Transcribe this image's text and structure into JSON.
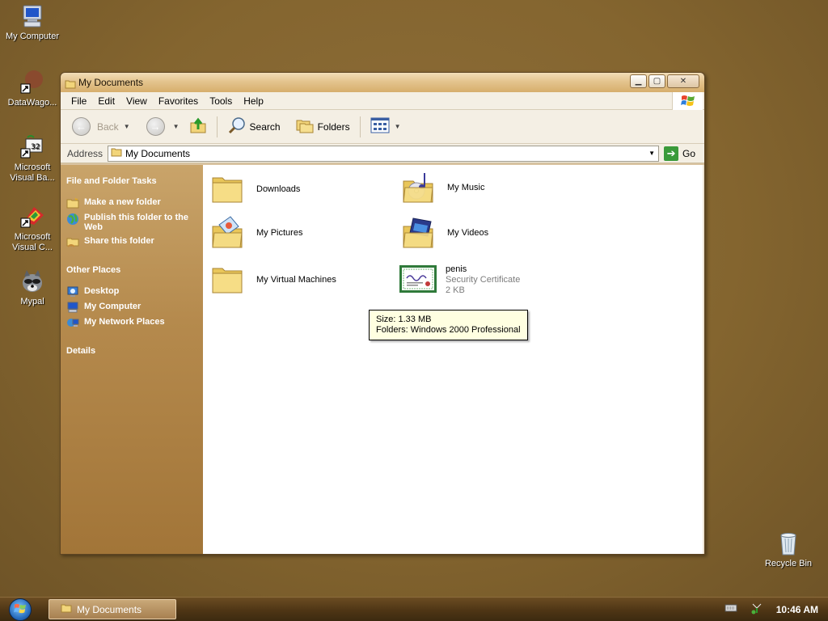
{
  "desktop": {
    "icons": [
      {
        "label": "My Computer"
      },
      {
        "label": "DataWago..."
      },
      {
        "label": "Microsoft Visual Ba..."
      },
      {
        "label": "Microsoft Visual C..."
      },
      {
        "label": "Mypal"
      },
      {
        "label": "Recycle Bin"
      }
    ]
  },
  "window": {
    "title": "My Documents",
    "buttons": {
      "minimize": "minimize",
      "maximize": "maximize",
      "close": "close"
    },
    "menu": [
      "File",
      "Edit",
      "View",
      "Favorites",
      "Tools",
      "Help"
    ],
    "toolbar": {
      "back": "Back",
      "search": "Search",
      "folders": "Folders"
    },
    "address": {
      "label": "Address",
      "value": "My Documents",
      "go": "Go"
    },
    "sidepane": {
      "tasks_title": "File and Folder Tasks",
      "tasks": [
        "Make a new folder",
        "Publish this folder to the Web",
        "Share this folder"
      ],
      "places_title": "Other Places",
      "places": [
        "Desktop",
        "My Computer",
        "My Network Places"
      ],
      "details_title": "Details"
    },
    "files": [
      {
        "name": "Downloads"
      },
      {
        "name": "My Music"
      },
      {
        "name": "My Pictures"
      },
      {
        "name": "My Videos"
      },
      {
        "name": "My Virtual Machines"
      },
      {
        "name": "penis",
        "type": "Security Certificate",
        "size": "2 KB"
      }
    ],
    "tooltip": {
      "line1": "Size: 1.33 MB",
      "line2": "Folders: Windows 2000 Professional"
    }
  },
  "taskbar": {
    "task": "My Documents",
    "clock": "10:46 AM"
  },
  "colors": {
    "desktop": "#84652f",
    "folder": "#f2d57a",
    "sidepane": "#b58a4d",
    "tooltip": "#ffffe1"
  }
}
